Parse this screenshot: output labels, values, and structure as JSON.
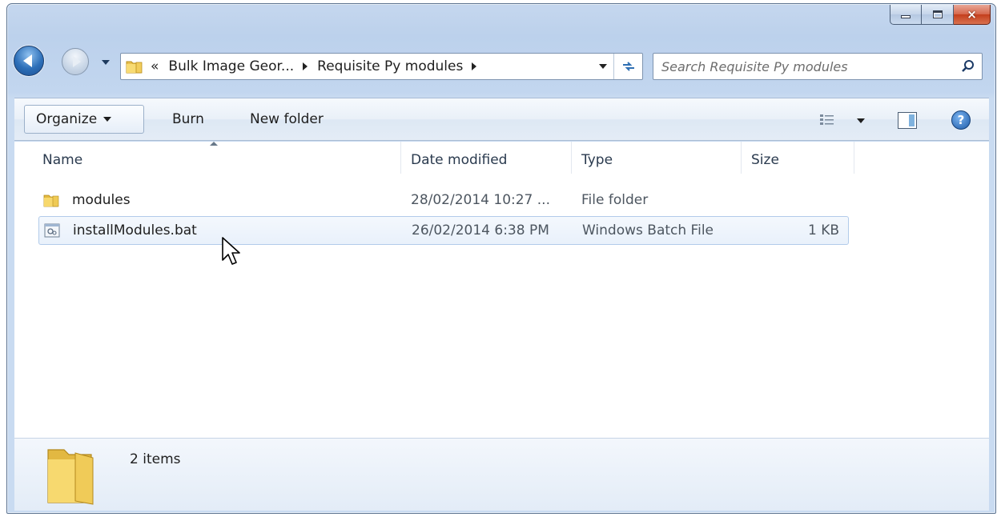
{
  "window": {
    "caption_buttons": {
      "minimize": "minimize",
      "maximize": "maximize",
      "close": "×"
    }
  },
  "nav": {
    "address": {
      "overflow": "«",
      "crumbs": [
        "Bulk Image Geor...",
        "Requisite Py modules"
      ]
    },
    "search": {
      "placeholder": "Search Requisite Py modules"
    }
  },
  "command_bar": {
    "organize_label": "Organize",
    "burn_label": "Burn",
    "new_folder_label": "New folder"
  },
  "columns": {
    "name": "Name",
    "date_modified": "Date modified",
    "type": "Type",
    "size": "Size"
  },
  "files": [
    {
      "name": "modules",
      "date": "28/02/2014 10:27 ...",
      "type": "File folder",
      "size": "",
      "icon": "folder-icon"
    },
    {
      "name": "installModules.bat",
      "date": "26/02/2014 6:38 PM",
      "type": "Windows Batch File",
      "size": "1 KB",
      "icon": "batch-file-icon"
    }
  ],
  "status": {
    "count": "2 items"
  },
  "colors": {
    "accent": "#2d6fb8",
    "selection_border": "#b2cbea",
    "folder": "#f5d66a"
  }
}
